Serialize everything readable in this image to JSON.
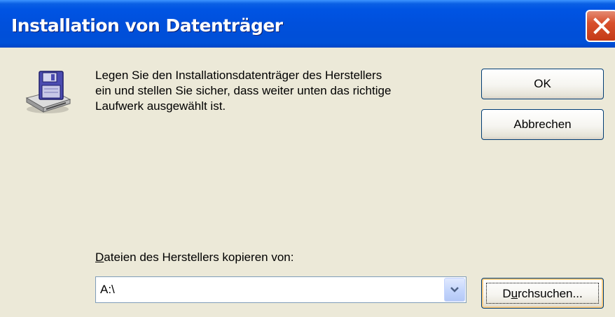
{
  "window": {
    "title": "Installation von Datenträger",
    "close_icon": "close-icon",
    "titlebar_color": "#0054e3",
    "close_color": "#d8502c"
  },
  "dialog": {
    "icon": "floppy-disk-drive-icon",
    "message_line1": "Legen Sie den Installationsdatenträger des Herstellers",
    "message_line2": "ein und stellen Sie sicher, dass weiter unten das richtige",
    "message_line3": "Laufwerk ausgewählt ist.",
    "ok_label": "OK",
    "cancel_label": "Abbrechen",
    "copy_from_label_mnemonic": "D",
    "copy_from_label_rest": "ateien des Herstellers kopieren von:",
    "path_value": "A:\\",
    "dropdown_icon": "chevron-down-icon",
    "browse_label_pre": "D",
    "browse_label_mnemonic": "u",
    "browse_label_post": "rchsuchen..."
  }
}
